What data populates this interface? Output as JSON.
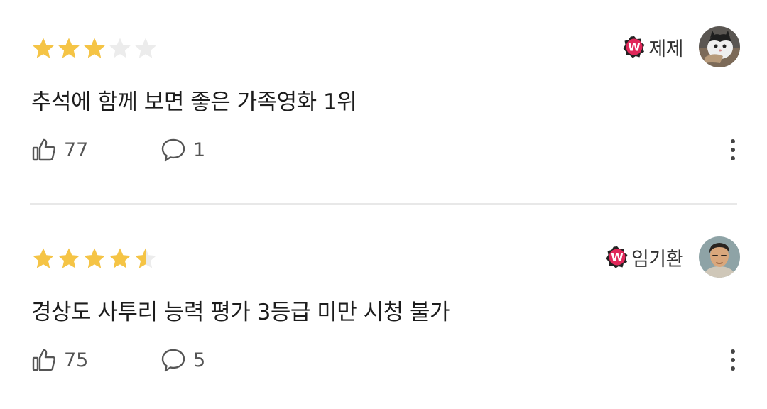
{
  "colors": {
    "star_filled": "#f5c445",
    "star_empty": "#ececec",
    "badge": "#e0285a",
    "text": "#222222",
    "muted": "#555555",
    "divider": "#e8e8e8"
  },
  "icons": {
    "star": "star-icon",
    "badge": "watcha-w-badge",
    "like": "thumbs-up-icon",
    "reply": "speech-bubble-icon",
    "more": "more-vertical-icon"
  },
  "reviews": [
    {
      "rating": 3.0,
      "max_rating": 5,
      "username": "제제",
      "badge_letter": "W",
      "text": "추석에 함께 보면 좋은 가족영화 1위",
      "likes": "77",
      "replies": "1"
    },
    {
      "rating": 4.5,
      "max_rating": 5,
      "username": "임기환",
      "badge_letter": "W",
      "text": "경상도 사투리 능력 평가 3등급 미만 시청 불가",
      "likes": "75",
      "replies": "5"
    }
  ]
}
